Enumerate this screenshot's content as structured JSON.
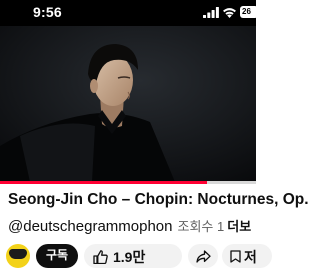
{
  "status_bar": {
    "time": "9:56",
    "battery": "26",
    "icons": [
      "signal-icon",
      "wifi-icon",
      "battery-icon"
    ]
  },
  "player": {
    "progress_fraction": 0.81,
    "progress_color": "#ff0033"
  },
  "video": {
    "title": "Seong-Jin Cho – Chopin: Nocturnes, Op.",
    "channel": "@deutschegrammophon",
    "views_label": "조회수 1",
    "more_label": "더보"
  },
  "actions": {
    "subscribe_label": "구독",
    "like_count": "1.9만",
    "save_label": "저"
  }
}
